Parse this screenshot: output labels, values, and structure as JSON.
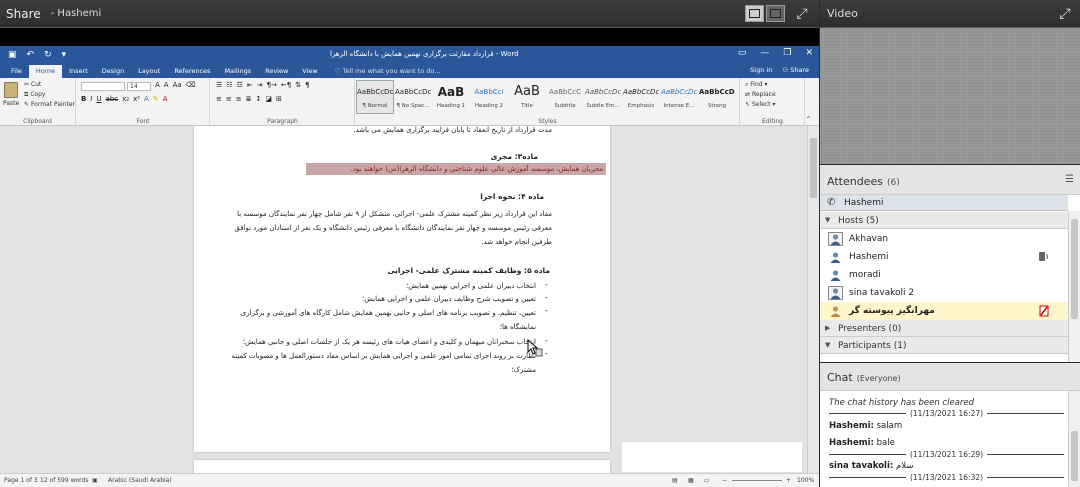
{
  "share": {
    "title": "Share",
    "presenter": "- Hashemi"
  },
  "word": {
    "doc_title": "قرارداد مقارئت برگزاری نهمین همایش با دانشگاه الزهرا - Word",
    "tabs": [
      "File",
      "Home",
      "Insert",
      "Design",
      "Layout",
      "References",
      "Mailings",
      "Review",
      "View"
    ],
    "tell_me": "Tell me what you want to do...",
    "sign_in": "Sign in",
    "share": "Share",
    "clipboard": {
      "paste": "Paste",
      "cut": "Cut",
      "copy": "Copy",
      "format_painter": "Format Painter",
      "label": "Clipboard"
    },
    "font": {
      "name": "",
      "size": "14",
      "label": "Font"
    },
    "paragraph_label": "Paragraph",
    "styles_label": "Styles",
    "editing": {
      "find": "Find",
      "replace": "Replace",
      "select": "Select",
      "label": "Editing"
    },
    "styles": [
      {
        "sample": "AaBbCcDc",
        "name": "¶ Normal"
      },
      {
        "sample": "AaBbCcDc",
        "name": "¶ No Spac..."
      },
      {
        "sample": "AaB",
        "name": "Heading 1"
      },
      {
        "sample": "AaBbCcI",
        "name": "Heading 2"
      },
      {
        "sample": "AaB",
        "name": "Title"
      },
      {
        "sample": "AaBbCcC",
        "name": "Subtitle"
      },
      {
        "sample": "AaBbCcDc",
        "name": "Subtle Em..."
      },
      {
        "sample": "AaBbCcDc",
        "name": "Emphasis"
      },
      {
        "sample": "AaBbCcDc",
        "name": "Intense E..."
      },
      {
        "sample": "AaBbCcDc",
        "name": "Strong"
      }
    ],
    "document_lines": {
      "l1": "مدت قرارداد از تاریخ انعقاد تا پایان فرایند برگزاری همایش می باشد.",
      "h2": "ماده۳: مجری",
      "l2": "مجریان همایش، موسسه آموزش عالی علوم شناختی و دانشگاه الزهرا(س) خواهند بود.",
      "h3": "ماده ۴: نحوه اجرا",
      "p3a": "مفاد این قرارداد زیر نظر کمیته مشترک علمی- اجرائی، متشکل از ۹ نفر شامل چهار نفر نمایندگان موسسه با",
      "p3b": "معرفی رئیس موسسه و چهار نفر نمایندگان  دانشگاه با معرفی رئیس دانشگاه و یک نفر از استادان مورد توافق",
      "p3c": "طرفین انجام خواهد شد.",
      "h4": "ماده ۵: وظایف کمیته مشترک علمی- اجرایی",
      "b1": "انتخاب دبیران علمی و اجرایی نهمین همایش؛",
      "b2": "تعیین و تصویب شرح وظایف دبیران علمی و اجرایی همایش؛",
      "b3a": "تعیین، تنظیم، و تصویب برنامه های اصلی و جانبی نهمین همایش شامل کارگاه های آموزشی و برگزاری",
      "b3b": "نمایشگاه ها؛",
      "b4": "انتخاب سخنرانان میهمان و کلیدی و اعضای هیات های رئیسه هر یک از جلسات اصلی و جانبی همایش؛",
      "b5a": "نظارت بر روند اجرای تمامی امور علمی و اجرایی همایش بر اساس مفاد دستورالعمل ها و مصوبات کمیته",
      "b5b": "مشترک؛"
    },
    "status": {
      "page": "Page 1 of 3",
      "words": "12 of 599 words",
      "language": "Arabic (Saudi Arabia)",
      "zoom": "100%"
    }
  },
  "video": {
    "title": "Video"
  },
  "attendees": {
    "title": "Attendees",
    "count": "(6)",
    "me": "Hashemi",
    "hosts_label": "Hosts (5)",
    "hosts": [
      "Akhavan",
      "Hashemi",
      "moradi",
      "sina tavakoli 2",
      "مهرانگیز پیوسته گر"
    ],
    "presenters_label": "Presenters (0)",
    "participants_label": "Participants (1)"
  },
  "chat": {
    "title": "Chat",
    "scope": "(Everyone)",
    "cleared": "The chat history has been cleared",
    "entries": [
      {
        "ts": "(11/13/2021 16:27)"
      },
      {
        "sender": "Hashemi:",
        "text": "salam"
      },
      {
        "sender": "Hashemi:",
        "text": "bale"
      },
      {
        "ts": "(11/13/2021 16:29)"
      },
      {
        "sender": "sina tavakoli:",
        "text": "سلام"
      },
      {
        "ts": "(11/13/2021 16:32)"
      }
    ]
  },
  "colors": {
    "word_blue": "#2b579a",
    "pod_dark": "#2e2e2e",
    "highlight": "#c9a6a6"
  }
}
